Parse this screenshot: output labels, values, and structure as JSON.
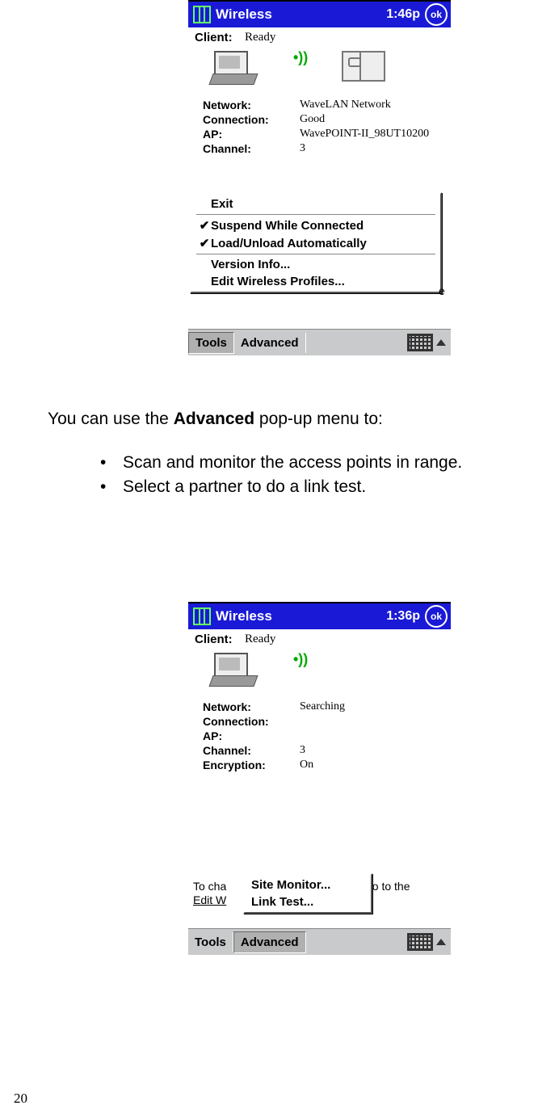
{
  "figure1": {
    "title": "Wireless",
    "time": "1:46p",
    "ok": "ok",
    "client_label": "Client:",
    "client_status": "Ready",
    "signal": "•))",
    "info": {
      "network_label": "Network:",
      "network_value": "WaveLAN Network",
      "connection_label": "Connection:",
      "connection_value": "Good",
      "ap_label": "AP:",
      "ap_value": "WavePOINT-II_98UT10200",
      "channel_label": "Channel:",
      "channel_value": "3"
    },
    "menu": {
      "exit": "Exit",
      "suspend": "Suspend While Connected",
      "load": "Load/Unload Automatically",
      "version": "Version Info...",
      "edit": "Edit Wireless Profiles..."
    },
    "stray_e": "e",
    "bottombar": {
      "tools": "Tools",
      "advanced": "Advanced"
    }
  },
  "body": {
    "p1_a": "You can use the ",
    "p1_b": "Advanced",
    "p1_c": " pop-up menu to:",
    "bullet1": "Scan and monitor the access points in range.",
    "bullet2": "Select a partner to do a link test."
  },
  "figure2": {
    "title": "Wireless",
    "time": "1:36p",
    "ok": "ok",
    "client_label": "Client:",
    "client_status": "Ready",
    "signal": "•))",
    "info": {
      "network_label": "Network:",
      "network_value": "Searching",
      "connection_label": "Connection:",
      "connection_value": "",
      "ap_label": "AP:",
      "ap_value": "",
      "channel_label": "Channel:",
      "channel_value": "3",
      "encryption_label": "Encryption:",
      "encryption_value": "On"
    },
    "bottom_text": {
      "line1": "To cha",
      "line2": "Edit W",
      "go_to_the": "go to the"
    },
    "menu": {
      "site": "Site Monitor...",
      "link": "Link Test..."
    },
    "bottombar": {
      "tools": "Tools",
      "advanced": "Advanced"
    }
  },
  "page_number": "20"
}
